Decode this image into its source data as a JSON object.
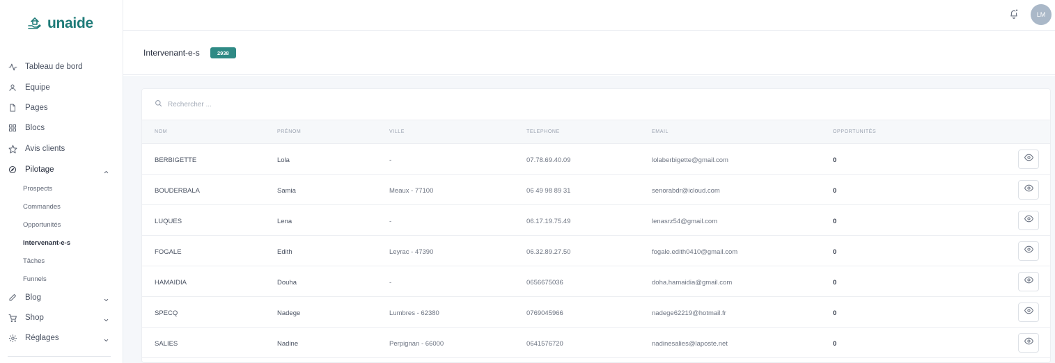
{
  "brand": {
    "name": "unaide",
    "color": "#1e7b78"
  },
  "nav": {
    "items": [
      {
        "label": "Tableau de bord",
        "icon": "activity-icon"
      },
      {
        "label": "Equipe",
        "icon": "user-icon"
      },
      {
        "label": "Pages",
        "icon": "file-icon"
      },
      {
        "label": "Blocs",
        "icon": "grid-icon"
      },
      {
        "label": "Avis clients",
        "icon": "star-icon"
      },
      {
        "label": "Pilotage",
        "icon": "compass-icon",
        "expanded": true
      }
    ],
    "pilotage_sub": [
      "Prospects",
      "Commandes",
      "Opportunités",
      "Intervenant-e-s",
      "Tâches",
      "Funnels"
    ],
    "active_sub": "Intervenant-e-s",
    "bottom_items": [
      {
        "label": "Blog",
        "icon": "pen-icon"
      },
      {
        "label": "Shop",
        "icon": "cart-icon"
      },
      {
        "label": "Réglages",
        "icon": "gear-icon"
      }
    ]
  },
  "topbar": {
    "avatar_initials": "LM"
  },
  "page": {
    "title": "Intervenant-e-s",
    "count": "2938",
    "badge_color": "#2f8a85"
  },
  "search": {
    "placeholder": "Rechercher ..."
  },
  "table": {
    "headers": {
      "nom": "NOM",
      "prenom": "PRÉNOM",
      "ville": "VILLE",
      "telephone": "TELEPHONE",
      "email": "EMAIL",
      "opportunites": "OPPORTUNITÉS"
    },
    "rows": [
      {
        "nom": "BERBIGETTE",
        "prenom": "Lola",
        "ville": "-",
        "telephone": "07.78.69.40.09",
        "email": "lolaberbigette@gmail.com",
        "opportunites": "0"
      },
      {
        "nom": "BOUDERBALA",
        "prenom": "Samia",
        "ville": "Meaux - 77100",
        "telephone": "06 49 98 89 31",
        "email": "senorabdr@icloud.com",
        "opportunites": "0"
      },
      {
        "nom": "LUQUES",
        "prenom": "Lena",
        "ville": "-",
        "telephone": "06.17.19.75.49",
        "email": "lenasrz54@gmail.com",
        "opportunites": "0"
      },
      {
        "nom": "FOGALE",
        "prenom": "Edith",
        "ville": "Leyrac - 47390",
        "telephone": "06.32.89.27.50",
        "email": "fogale.edith0410@gmail.com",
        "opportunites": "0"
      },
      {
        "nom": "HAMAIDIA",
        "prenom": "Douha",
        "ville": "-",
        "telephone": "0656675036",
        "email": "doha.hamaidia@gmail.com",
        "opportunites": "0"
      },
      {
        "nom": "SPECQ",
        "prenom": "Nadege",
        "ville": "Lumbres - 62380",
        "telephone": "0769045966",
        "email": "nadege62219@hotmail.fr",
        "opportunites": "0"
      },
      {
        "nom": "SALIES",
        "prenom": "Nadine",
        "ville": "Perpignan - 66000",
        "telephone": "0641576720",
        "email": "nadinesalies@laposte.net",
        "opportunites": "0"
      }
    ]
  }
}
